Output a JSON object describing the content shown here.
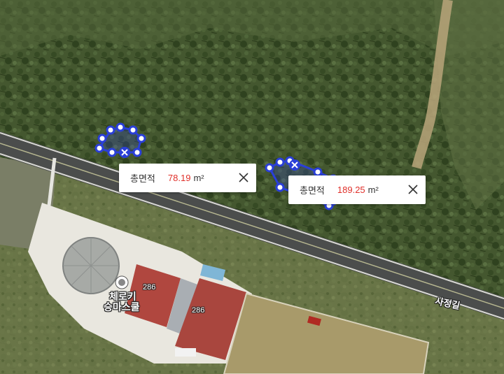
{
  "measurements": [
    {
      "title": "총면적",
      "value": "78.19",
      "unit": "m²"
    },
    {
      "title": "총면적",
      "value": "189.25",
      "unit": "m²"
    }
  ],
  "map_labels": {
    "poi_name_line1": "체로키",
    "poi_name_line2": "승마스쿨",
    "road_name": "사정길",
    "building_number_1": "286",
    "building_number_2": "286"
  },
  "colors": {
    "measurement_stroke": "#2a3fd8",
    "measurement_value": "#e0302a",
    "popup_background": "#ffffff"
  },
  "icons": {
    "measurement_vertex": "vertex-handle-icon",
    "measurement_delete": "delete-x-icon",
    "popup_close": "close-icon",
    "poi_marker": "poi-marker-icon"
  }
}
